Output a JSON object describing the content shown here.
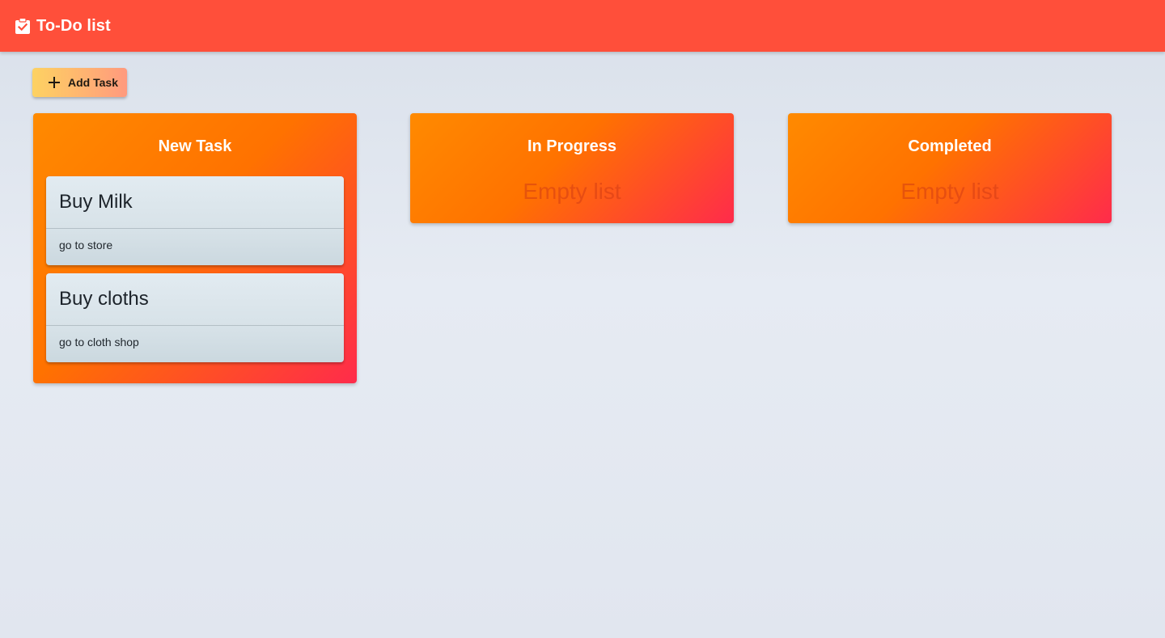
{
  "app": {
    "title": "To-Do list",
    "icon": "clipboard-check-icon",
    "colors": {
      "appbar": "#ff4f3a",
      "column_gradient_start": "#ff8a00",
      "column_gradient_end": "#ff2b4b",
      "add_button_start": "#fdd262",
      "add_button_end": "#ff9a7e"
    }
  },
  "toolbar": {
    "add_label": "Add Task",
    "add_icon": "plus-icon"
  },
  "columns": [
    {
      "title": "New Task",
      "empty_text": "",
      "tasks": [
        {
          "title": "Buy Milk",
          "description": "go to store"
        },
        {
          "title": "Buy cloths",
          "description": "go to cloth shop"
        }
      ]
    },
    {
      "title": "In Progress",
      "empty_text": "Empty list",
      "tasks": []
    },
    {
      "title": "Completed",
      "empty_text": "Empty list",
      "tasks": []
    }
  ]
}
